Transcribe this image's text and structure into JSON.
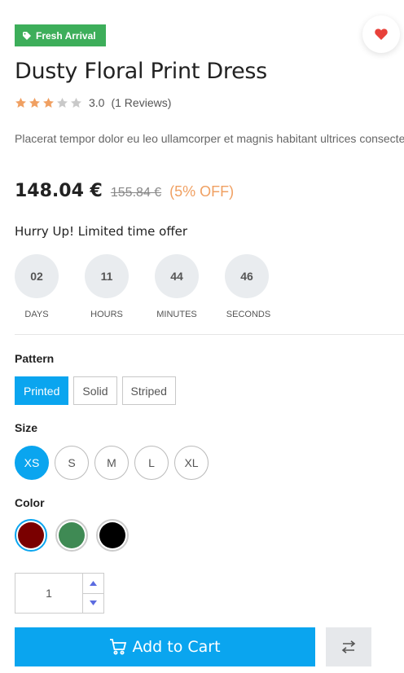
{
  "badge": {
    "label": "Fresh Arrival",
    "color": "#3dae5a"
  },
  "wishlist": {
    "icon": "heart-icon",
    "color": "#e8413a"
  },
  "product": {
    "title": "Dusty Floral Print Dress",
    "rating": {
      "value": "3.0",
      "stars_filled": 3,
      "stars_total": 5,
      "reviews": "(1 Reviews)"
    },
    "description": "Placerat tempor dolor eu leo ullamcorper et magnis habitant ultrices consectetur fermentum adipiscing a et bibendum sed platea malesuada eget.",
    "price": {
      "current": "148.04 €",
      "old": "155.84 €",
      "discount": "(5% OFF)"
    }
  },
  "offer": {
    "heading": "Hurry Up! Limited time offer",
    "countdown": [
      {
        "value": "02",
        "label": "DAYS"
      },
      {
        "value": "11",
        "label": "HOURS"
      },
      {
        "value": "44",
        "label": "MINUTES"
      },
      {
        "value": "46",
        "label": "SECONDS"
      }
    ]
  },
  "pattern": {
    "label": "Pattern",
    "options": [
      "Printed",
      "Solid",
      "Striped"
    ],
    "selected": 0
  },
  "size": {
    "label": "Size",
    "options": [
      "XS",
      "S",
      "M",
      "L",
      "XL"
    ],
    "selected": 0
  },
  "color": {
    "label": "Color",
    "swatches": [
      "#7a0000",
      "#3f8a54",
      "#000000"
    ],
    "selected": 0
  },
  "quantity": {
    "value": "1"
  },
  "actions": {
    "add_to_cart": "Add to Cart",
    "accent": "#0aa5ef"
  }
}
